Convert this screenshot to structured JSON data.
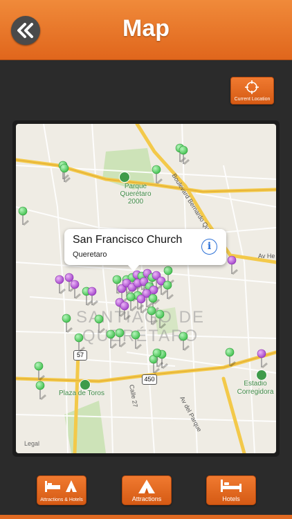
{
  "header": {
    "title": "Map",
    "back_icon": "double-chevron-left-icon"
  },
  "current_location": {
    "label": "Current Location",
    "icon": "crosshair-icon"
  },
  "map": {
    "legal": "Legal",
    "labels": {
      "park": "Parque Querétaro 2000",
      "city": "SANTIAGO DE QUERÉTARO",
      "plaza": "Plaza de Toros",
      "stadium": "Estadio Corregidora",
      "blvd": "Boulevard Bernardo Quintana",
      "av_he": "Av He",
      "calle27": "Calle 27",
      "av_parque": "Av del Parque",
      "shield57": "57",
      "shield450": "450"
    },
    "callout": {
      "title": "San Francisco Church",
      "subtitle": "Queretaro"
    },
    "pin_colors": {
      "attraction": "#5fd06a",
      "hotel": "#b45ad8"
    }
  },
  "toolbar": {
    "attractions_hotels": "Attractions & Hotels",
    "attractions": "Attractions",
    "hotels": "Hotels"
  },
  "colors": {
    "accent": "#e8702a",
    "background": "#2b2b2b"
  }
}
